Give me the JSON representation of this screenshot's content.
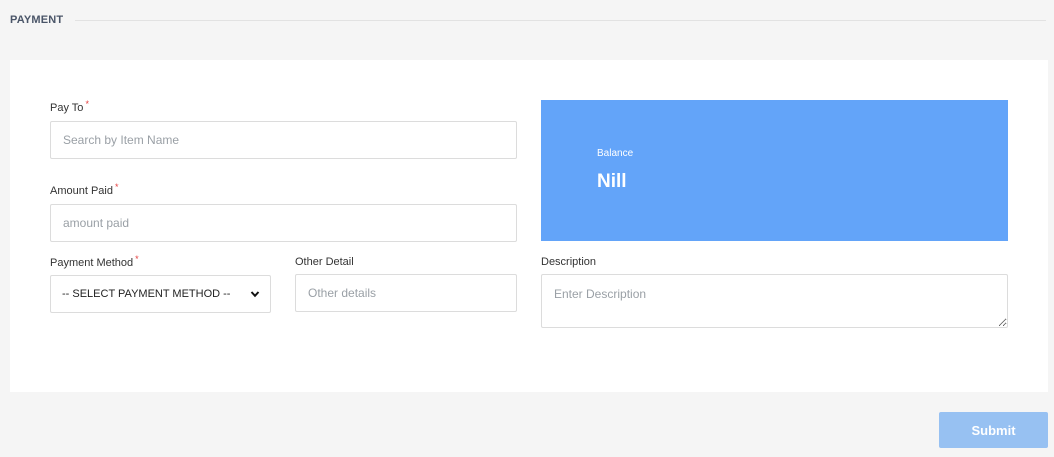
{
  "section": {
    "title": "PAYMENT"
  },
  "form": {
    "pay_to": {
      "label": "Pay To",
      "required_mark": "*",
      "value": "",
      "placeholder": "Search by Item Name"
    },
    "amount_paid": {
      "label": "Amount Paid",
      "required_mark": "*",
      "value": "",
      "placeholder": "amount paid"
    },
    "payment_method": {
      "label": "Payment Method",
      "required_mark": "*",
      "selected": "-- SELECT PAYMENT METHOD --"
    },
    "other_detail": {
      "label": "Other Detail",
      "value": "",
      "placeholder": "Other details"
    },
    "description": {
      "label": "Description",
      "value": "",
      "placeholder": "Enter Description"
    }
  },
  "balance": {
    "label": "Balance",
    "value": "Nill"
  },
  "actions": {
    "submit_label": "Submit"
  },
  "colors": {
    "balance_panel": "#63a4f9",
    "submit_button": "#97c1f2",
    "required": "#e53e3e",
    "page_bg": "#f5f5f5"
  },
  "icons": {
    "select_arrow": "chevron-down-icon"
  }
}
